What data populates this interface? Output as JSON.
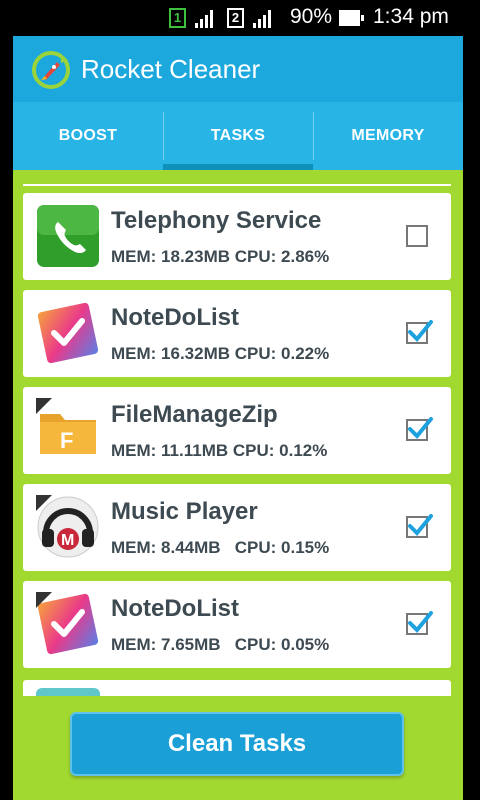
{
  "status_bar": {
    "sim1": "1",
    "sim2": "2",
    "battery": "90%",
    "time": "1:34 pm"
  },
  "app": {
    "title": "Rocket Cleaner"
  },
  "tabs": [
    {
      "label": "BOOST",
      "active": false
    },
    {
      "label": "TASKS",
      "active": true
    },
    {
      "label": "MEMORY",
      "active": false
    }
  ],
  "tasks": [
    {
      "name": "Telephony Service",
      "mem": "MEM: 18.23MB",
      "cpu": "CPU: 2.86%",
      "checked": false,
      "icon": "phone-icon"
    },
    {
      "name": "NoteDoList",
      "mem": "MEM: 16.32MB",
      "cpu": "CPU: 0.22%",
      "checked": true,
      "icon": "notedolist-icon"
    },
    {
      "name": "FileManageZip",
      "mem": "MEM: 11.11MB",
      "cpu": "CPU: 0.12%",
      "checked": true,
      "icon": "folder-icon"
    },
    {
      "name": "Music Player",
      "mem": "MEM: 8.44MB",
      "cpu": "CPU: 0.15%",
      "checked": true,
      "icon": "headphones-icon"
    },
    {
      "name": "NoteDoList",
      "mem": "MEM: 7.65MB",
      "cpu": "CPU: 0.05%",
      "checked": true,
      "icon": "notedolist-icon"
    }
  ],
  "actions": {
    "clean_label": "Clean Tasks"
  },
  "colors": {
    "app_bar": "#1da8dd",
    "tabs": "#29b4e6",
    "content_bg": "#a2d930",
    "checkbox_blue": "#1da1df",
    "button": "#1a9fd6"
  }
}
